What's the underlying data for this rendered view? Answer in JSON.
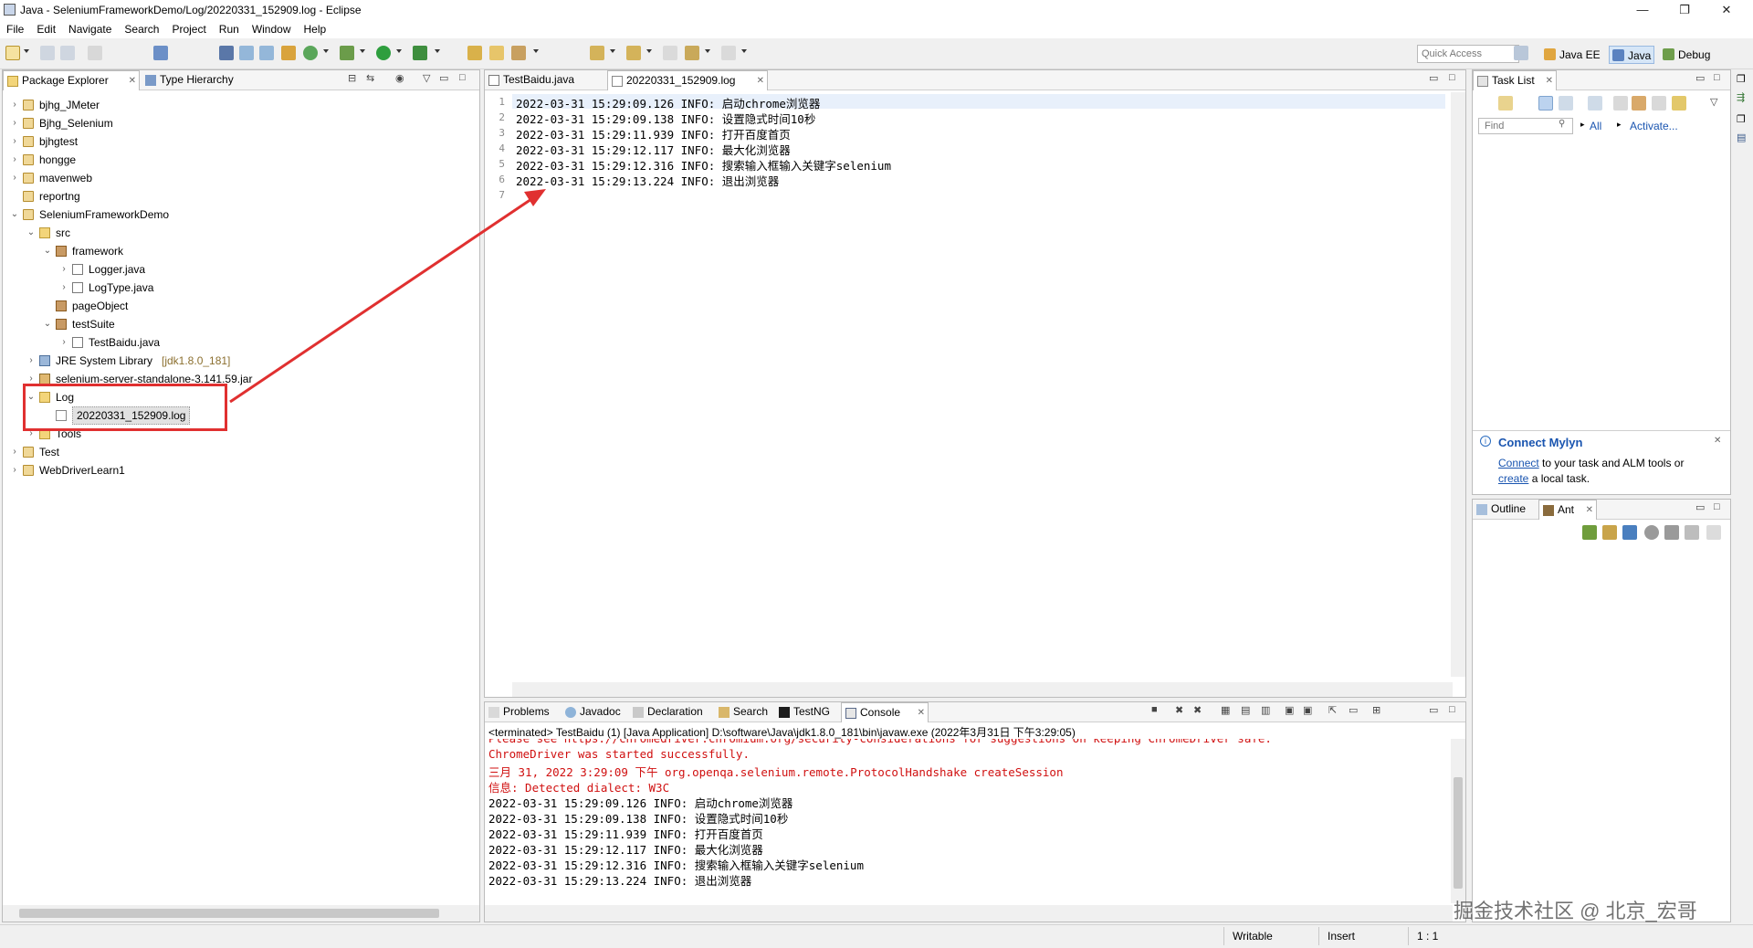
{
  "window": {
    "title": "Java - SeleniumFrameworkDemo/Log/20220331_152909.log - Eclipse",
    "min": "—",
    "max": "❐",
    "close": "✕"
  },
  "menu": [
    "File",
    "Edit",
    "Navigate",
    "Search",
    "Project",
    "Run",
    "Window",
    "Help"
  ],
  "toolbar": {
    "quick_access": "Quick Access",
    "perspectives": [
      "Java EE",
      "Java",
      "Debug"
    ]
  },
  "package_explorer": {
    "tabs": [
      "Package Explorer",
      "Type Hierarchy"
    ],
    "items": [
      {
        "label": "bjhg_JMeter",
        "depth": 0,
        "expand": "›",
        "icon": "proj"
      },
      {
        "label": "Bjhg_Selenium",
        "depth": 0,
        "expand": "›",
        "icon": "proj"
      },
      {
        "label": "bjhgtest",
        "depth": 0,
        "expand": "›",
        "icon": "proj"
      },
      {
        "label": "hongge",
        "depth": 0,
        "expand": "›",
        "icon": "proj"
      },
      {
        "label": "mavenweb",
        "depth": 0,
        "expand": "›",
        "icon": "proj"
      },
      {
        "label": "reportng",
        "depth": 0,
        "expand": "",
        "icon": "proj"
      },
      {
        "label": "SeleniumFrameworkDemo",
        "depth": 0,
        "expand": "⌄",
        "icon": "proj"
      },
      {
        "label": "src",
        "depth": 1,
        "expand": "⌄",
        "icon": "folder"
      },
      {
        "label": "framework",
        "depth": 2,
        "expand": "⌄",
        "icon": "pkg"
      },
      {
        "label": "Logger.java",
        "depth": 3,
        "expand": "›",
        "icon": "java"
      },
      {
        "label": "LogType.java",
        "depth": 3,
        "expand": "›",
        "icon": "java"
      },
      {
        "label": "pageObject",
        "depth": 2,
        "expand": "",
        "icon": "pkg"
      },
      {
        "label": "testSuite",
        "depth": 2,
        "expand": "⌄",
        "icon": "pkg"
      },
      {
        "label": "TestBaidu.java",
        "depth": 3,
        "expand": "›",
        "icon": "java"
      },
      {
        "label": "JRE System Library",
        "suffix": "[jdk1.8.0_181]",
        "depth": 1,
        "expand": "›",
        "icon": "lib"
      },
      {
        "label": "selenium-server-standalone-3.141.59.jar",
        "depth": 1,
        "expand": "›",
        "icon": "jar"
      },
      {
        "label": "Log",
        "depth": 1,
        "expand": "⌄",
        "icon": "folder"
      },
      {
        "label": "20220331_152909.log",
        "depth": 2,
        "expand": "",
        "icon": "logf",
        "selected": true
      },
      {
        "label": "Tools",
        "depth": 1,
        "expand": "›",
        "icon": "folder"
      },
      {
        "label": "Test",
        "depth": 0,
        "expand": "›",
        "icon": "proj"
      },
      {
        "label": "WebDriverLearn1",
        "depth": 0,
        "expand": "›",
        "icon": "proj"
      }
    ]
  },
  "editor": {
    "tabs": [
      "TestBaidu.java",
      "20220331_152909.log"
    ],
    "line_numbers": [
      "1",
      "2",
      "3",
      "4",
      "5",
      "6",
      "7"
    ],
    "lines": [
      "2022-03-31 15:29:09.126 INFO: 启动chrome浏览器",
      "2022-03-31 15:29:09.138 INFO: 设置隐式时间10秒",
      "2022-03-31 15:29:11.939 INFO: 打开百度首页",
      "2022-03-31 15:29:12.117 INFO: 最大化浏览器",
      "2022-03-31 15:29:12.316 INFO: 搜索输入框输入关键字selenium",
      "2022-03-31 15:29:13.224 INFO: 退出浏览器",
      ""
    ]
  },
  "task_list": {
    "tab": "Task List",
    "find_placeholder": "Find",
    "all": "All",
    "activate": "Activate...",
    "mylyn_title": "Connect Mylyn",
    "mylyn_connect": "Connect",
    "mylyn_text1": " to your task and ALM tools or",
    "mylyn_create": "create",
    "mylyn_text2": " a local task."
  },
  "outline": {
    "tabs": [
      "Outline",
      "Ant"
    ]
  },
  "bottom": {
    "tabs": [
      "Problems",
      "Javadoc",
      "Declaration",
      "Search",
      "TestNG",
      "Console"
    ],
    "terminated": "<terminated> TestBaidu (1) [Java Application] D:\\software\\Java\\jdk1.8.0_181\\bin\\javaw.exe (2022年3月31日 下午3:29:05)",
    "red_lines": [
      "Please see https://chromedriver.chromium.org/security-considerations for suggestions on keeping ChromeDriver safe.",
      "ChromeDriver was started successfully.",
      "三月 31, 2022 3:29:09 下午 org.openqa.selenium.remote.ProtocolHandshake createSession",
      "信息: Detected dialect: W3C"
    ],
    "black_lines": [
      "2022-03-31 15:29:09.126 INFO: 启动chrome浏览器",
      "2022-03-31 15:29:09.138 INFO: 设置隐式时间10秒",
      "2022-03-31 15:29:11.939 INFO: 打开百度首页",
      "2022-03-31 15:29:12.117 INFO: 最大化浏览器",
      "2022-03-31 15:29:12.316 INFO: 搜索输入框输入关键字selenium",
      "2022-03-31 15:29:13.224 INFO: 退出浏览器"
    ]
  },
  "status": {
    "writable": "Writable",
    "insert": "Insert",
    "position": "1 : 1"
  },
  "watermark": "掘金技术社区 @ 北京_宏哥",
  "colors": {
    "highlight_box": "#e03030",
    "console_red": "#d01010",
    "link": "#1a55b0"
  }
}
